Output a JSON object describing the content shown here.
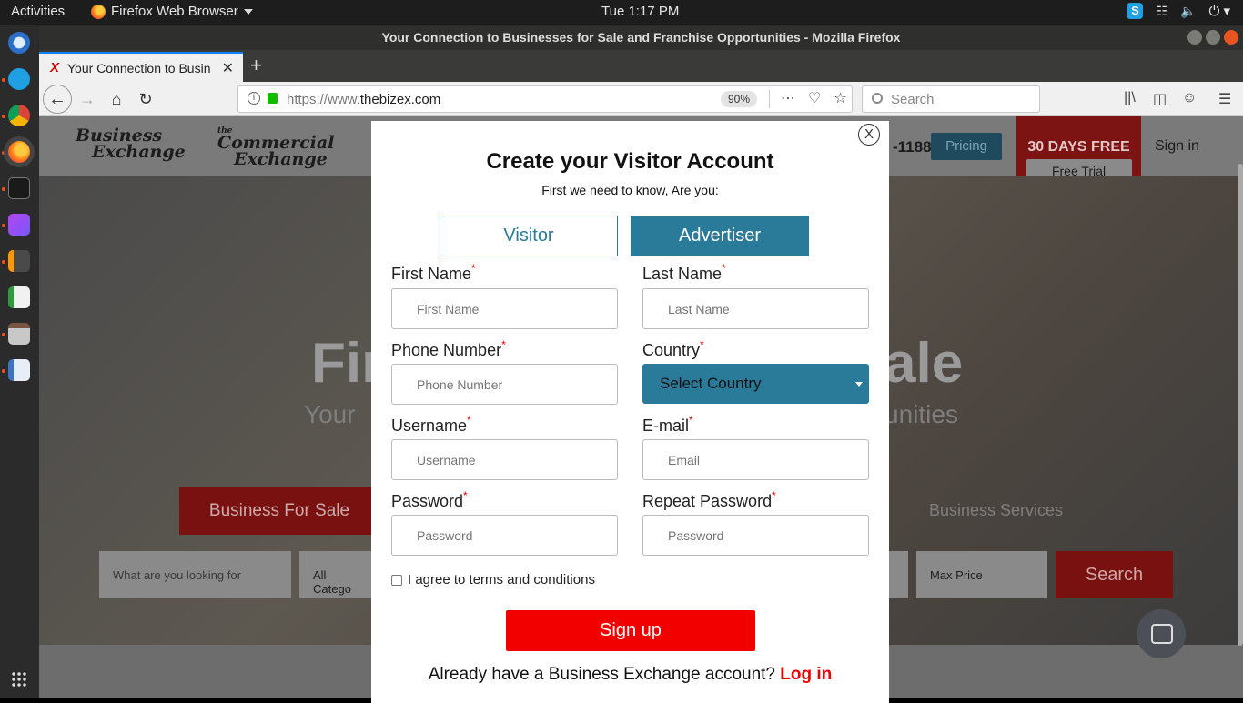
{
  "system": {
    "activities": "Activities",
    "app_menu": "Firefox Web Browser",
    "clock": "Tue  1:17 PM"
  },
  "window": {
    "title": "Your Connection to Businesses for Sale and Franchise Opportunities - Mozilla Firefox"
  },
  "browser": {
    "tab_title": "Your Connection to Busin",
    "url_prefix": "https://www.",
    "url_domain": "thebizex.com",
    "zoom": "90%",
    "search_placeholder": "Search"
  },
  "site": {
    "logo1_line1": "Business",
    "logo1_line2": "Exchange",
    "logo2_small": "the",
    "logo2_line1": "Commercial",
    "logo2_line2": "Exchange",
    "phone": "-1188",
    "pricing": "Pricing",
    "days_free": "30 DAYS FREE",
    "free_trial": "Free Trial",
    "sign_in": "Sign in",
    "hero_left": "Fir",
    "hero_right": "ale",
    "hero_sub_left": "Your",
    "hero_sub_right": "unities",
    "tab_bfs": "Business For Sale",
    "tab_bs": "Business Services",
    "search_placeholder": "What are you looking for",
    "category": "All Catego",
    "max_price": "Max Price",
    "search_btn": "Search"
  },
  "modal": {
    "close": "X",
    "title": "Create your Visitor Account",
    "subtitle": "First we need to know, Are you:",
    "role_visitor": "Visitor",
    "role_advertiser": "Advertiser",
    "first_name_label": "First Name",
    "first_name_ph": "First Name",
    "last_name_label": "Last Name",
    "last_name_ph": "Last Name",
    "phone_label": "Phone Number",
    "phone_ph": "Phone Number",
    "country_label": "Country",
    "country_value": "Select Country",
    "username_label": "Username",
    "username_ph": "Username",
    "email_label": "E-mail",
    "email_ph": "Email",
    "password_label": "Password",
    "password_ph": "Password",
    "repeat_label": "Repeat Password",
    "repeat_ph": "Password",
    "required_mark": "*",
    "agree": "I agree to terms and conditions",
    "signup": "Sign up",
    "already": "Already have a Business Exchange account?",
    "login": "Log in"
  }
}
